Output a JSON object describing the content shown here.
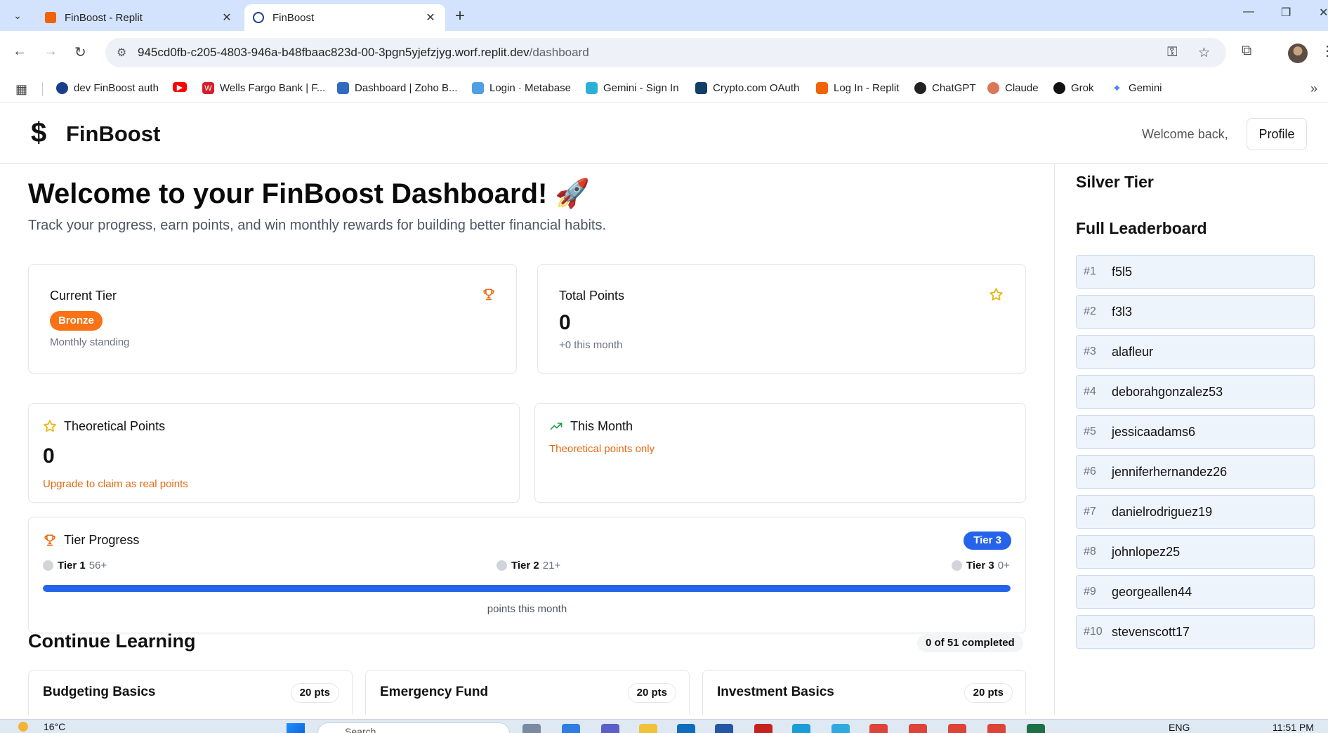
{
  "browser": {
    "tabs": [
      {
        "title": "FinBoost - Replit"
      },
      {
        "title": "FinBoost"
      }
    ],
    "url_host": "945cd0fb-c205-4803-946a-b48fbaac823d-00-3pgn5yjefzjyg.worf.replit.dev",
    "url_path": "/dashboard",
    "bookmarks": [
      {
        "label": "dev FinBoost auth"
      },
      {
        "label": ""
      },
      {
        "label": "Wells Fargo Bank | F..."
      },
      {
        "label": "Dashboard | Zoho B..."
      },
      {
        "label": "Login · Metabase"
      },
      {
        "label": "Gemini - Sign In"
      },
      {
        "label": "Crypto.com OAuth"
      },
      {
        "label": "Log In - Replit"
      },
      {
        "label": "ChatGPT"
      },
      {
        "label": "Claude"
      },
      {
        "label": "Grok"
      },
      {
        "label": "Gemini"
      }
    ]
  },
  "header": {
    "logo_icon": "$",
    "brand": "FinBoost",
    "welcome": "Welcome back,",
    "profile_button": "Profile"
  },
  "hero": {
    "title": "Welcome to your FinBoost Dashboard! 🚀",
    "subtitle": "Track your progress, earn points, and win monthly rewards for building better financial habits."
  },
  "stats": {
    "current_tier": {
      "title": "Current Tier",
      "badge": "Bronze",
      "caption": "Monthly standing",
      "icon": "trophy-icon"
    },
    "total_points": {
      "title": "Total Points",
      "value": "0",
      "caption": "+0 this month",
      "icon": "star-icon"
    },
    "theoretical_points": {
      "title": "Theoretical Points",
      "value": "0",
      "caption": "Upgrade to claim as real points",
      "icon": "star-icon"
    },
    "this_month": {
      "title": "This Month",
      "caption": "Theoretical points only",
      "icon": "trending-up-icon"
    }
  },
  "tier_progress": {
    "title": "Tier Progress",
    "badge": "Tier 3",
    "tiers": [
      {
        "name": "Tier 1",
        "range": "56+"
      },
      {
        "name": "Tier 2",
        "range": "21+"
      },
      {
        "name": "Tier 3",
        "range": "0+"
      }
    ],
    "progress_fraction": 1.0,
    "caption": "points this month"
  },
  "learning": {
    "title": "Continue Learning",
    "completed": "0 of 51 completed",
    "courses": [
      {
        "title": "Budgeting Basics",
        "points": "20 pts"
      },
      {
        "title": "Emergency Fund",
        "points": "20 pts"
      },
      {
        "title": "Investment Basics",
        "points": "20 pts"
      }
    ]
  },
  "sidebar": {
    "tier_title": "Silver Tier",
    "leaderboard_title": "Full Leaderboard",
    "leaderboard": [
      {
        "rank": "#1",
        "name": "f5l5"
      },
      {
        "rank": "#2",
        "name": "f3l3"
      },
      {
        "rank": "#3",
        "name": "alafleur"
      },
      {
        "rank": "#4",
        "name": "deborahgonzalez53"
      },
      {
        "rank": "#5",
        "name": "jessicaadams6"
      },
      {
        "rank": "#6",
        "name": "jenniferhernandez26"
      },
      {
        "rank": "#7",
        "name": "danielrodriguez19"
      },
      {
        "rank": "#8",
        "name": "johnlopez25"
      },
      {
        "rank": "#9",
        "name": "georgeallen44"
      },
      {
        "rank": "#10",
        "name": "stevenscott17"
      }
    ]
  },
  "taskbar": {
    "temperature": "16°C",
    "search_placeholder": "Search",
    "language": "ENG",
    "time": "11:51 PM"
  },
  "colors": {
    "accent_blue": "#2563eb",
    "bronze": "#f97316",
    "warning_text": "#e46a11",
    "leaderboard_bg": "#eef4fc"
  }
}
